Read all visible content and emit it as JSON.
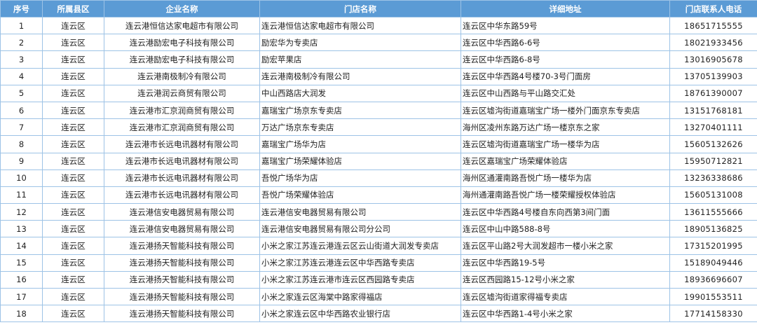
{
  "table": {
    "headers": [
      "序号",
      "所属县区",
      "企业名称",
      "门店名称",
      "详细地址",
      "门店联系人电话"
    ],
    "rows": [
      [
        "1",
        "连云区",
        "连云港恒信达家电超市有限公司",
        "连云港恒信达家电超市有限公司",
        "连云区中华东路59号",
        "18651715555"
      ],
      [
        "2",
        "连云区",
        "连云港励宏电子科技有限公司",
        "励宏华为专卖店",
        "连云区中华西路6-6号",
        "18021933456"
      ],
      [
        "3",
        "连云区",
        "连云港励宏电子科技有限公司",
        "励宏苹果店",
        "连云区中华西路6-8号",
        "13016905678"
      ],
      [
        "4",
        "连云区",
        "连云港南极制冷有限公司",
        "连云港南极制冷有限公司",
        "连云区中华西路4号楼70-3号门面房",
        "13705139903"
      ],
      [
        "5",
        "连云区",
        "连云港润云商贸有限公司",
        "中山西路店大润发",
        "连云区中山西路与平山路交汇处",
        "18761390007"
      ],
      [
        "6",
        "连云区",
        "连云港市汇京润商贸有限公司",
        "嘉瑞宝广场京东专卖店",
        "连云区墟沟街道嘉瑞宝广场一楼外门面京东专卖店",
        "13151768181"
      ],
      [
        "7",
        "连云区",
        "连云港市汇京润商贸有限公司",
        "万达广场京东专卖店",
        "海州区凌州东路万达广场一楼京东之家",
        "13270401111"
      ],
      [
        "8",
        "连云区",
        "连云港市长远电讯器材有限公司",
        "嘉瑞宝广场华为店",
        "连云区墟沟街道嘉瑞宝广场一楼华为店",
        "15605132626"
      ],
      [
        "9",
        "连云区",
        "连云港市长远电讯器材有限公司",
        "嘉瑞宝广场荣耀体验店",
        "连云区嘉瑞宝广场荣耀体验店",
        "15950712821"
      ],
      [
        "10",
        "连云区",
        "连云港市长远电讯器材有限公司",
        "吾悦广场华为店",
        "海州区通灌南路吾悦广场一楼华为店",
        "13236338686"
      ],
      [
        "11",
        "连云区",
        "连云港市长远电讯器材有限公司",
        "吾悦广场荣耀体验店",
        "海州通灌南路吾悦广场一楼荣耀授权体验店",
        "15605131008"
      ],
      [
        "12",
        "连云区",
        "连云港信安电器贸易有限公司",
        "连云港信安电器贸易有限公司",
        "连云区中华西路4号楼自东向西第3间门面",
        "13611555666"
      ],
      [
        "13",
        "连云区",
        "连云港信安电器贸易有限公司",
        "连云港信安电器贸易有限公司分公司",
        "连云区中山中路588-8号",
        "18905136825"
      ],
      [
        "14",
        "连云区",
        "连云港扬天智能科技有限公司",
        "小米之家江苏连云港连云区云山街道大润发专卖店",
        "连云区平山路2号大润发超市一楼小米之家",
        "17315201995"
      ],
      [
        "15",
        "连云区",
        "连云港扬天智能科技有限公司",
        "小米之家江苏连云港连云区中华西路专卖店",
        "连云区中华西路19-5号",
        "15189049446"
      ],
      [
        "16",
        "连云区",
        "连云港扬天智能科技有限公司",
        "小米之家江苏连云港市连云区西园路专卖店",
        "连云区西园路15-12号小米之家",
        "18936696607"
      ],
      [
        "17",
        "连云区",
        "连云港扬天智能科技有限公司",
        "小米之家连云区海棠中路家得福店",
        "连云区墟沟街道家得福专卖店",
        "19901553511"
      ],
      [
        "18",
        "连云区",
        "连云港扬天智能科技有限公司",
        "小米之家连云区中华西路农业银行店",
        "连云区中华西路1-4号小米之家",
        "17714158330"
      ]
    ]
  }
}
